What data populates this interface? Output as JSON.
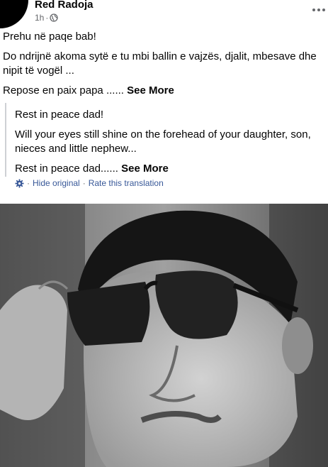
{
  "post": {
    "author": "Red Radoja",
    "time": "1h",
    "original_lines": [
      "Prehu në paqe bab!",
      "Do ndrijnë akoma sytë e tu mbi ballin e vajzës, djalit, mbesave dhe nipit të vogël ...",
      "Repose en paix papa ......"
    ],
    "see_more_label": "See More"
  },
  "translation": {
    "lines": [
      "Rest in peace dad!",
      "Will your eyes still shine on the forehead of your daughter, son, nieces and little nephew...",
      "Rest in peace dad......"
    ],
    "see_more_label": "See More",
    "hide_original_label": "Hide original",
    "separator": "·",
    "rate_label": "Rate this translation"
  },
  "colors": {
    "text": "#050505",
    "secondary": "#65676b",
    "link": "#385898"
  }
}
